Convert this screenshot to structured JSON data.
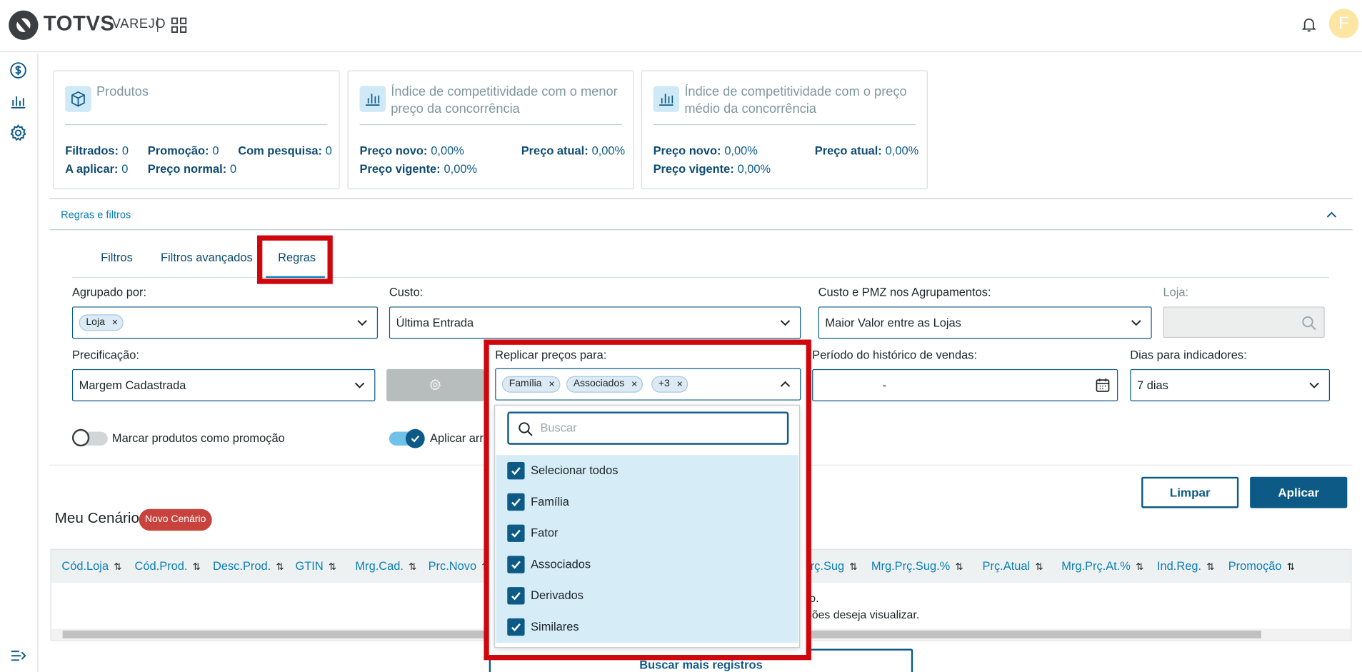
{
  "app": {
    "brand": "TOTVS",
    "brand_sub": "VAREJO",
    "avatar_letter": "F"
  },
  "colors": {
    "primary": "#0d5a86",
    "accent": "#0c7fb5",
    "highlight": "#d0060d",
    "badge": "#c8433d"
  },
  "sidebar": {
    "icons": [
      "dollar-icon",
      "bar-chart-icon",
      "gear-icon",
      "expand-menu-icon"
    ]
  },
  "cards": [
    {
      "title": "Produtos",
      "fields": [
        {
          "label": "Filtrados:",
          "value": "0"
        },
        {
          "label": "Promoção:",
          "value": "0"
        },
        {
          "label": "Com pesquisa:",
          "value": "0"
        },
        {
          "label": "A aplicar:",
          "value": "0"
        },
        {
          "label": "Preço normal:",
          "value": "0"
        }
      ]
    },
    {
      "title_l1": "Índice de competitividade com o menor",
      "title_l2": "preço da concorrência",
      "fields": [
        {
          "label": "Preço novo:",
          "value": "0,00%"
        },
        {
          "label": "Preço atual:",
          "value": "0,00%"
        },
        {
          "label": "Preço vigente:",
          "value": "0,00%"
        }
      ]
    },
    {
      "title_l1": "Índice de competitividade com o preço",
      "title_l2": "médio da concorrência",
      "fields": [
        {
          "label": "Preço novo:",
          "value": "0,00%"
        },
        {
          "label": "Preço atual:",
          "value": "0,00%"
        },
        {
          "label": "Preço vigente:",
          "value": "0,00%"
        }
      ]
    }
  ],
  "rules": {
    "section_title": "Regras e filtros",
    "tabs": [
      "Filtros",
      "Filtros avançados",
      "Regras"
    ],
    "active_tab": "Regras",
    "agrupado": {
      "label": "Agrupado por:",
      "chip": "Loja"
    },
    "custo": {
      "label": "Custo:",
      "value": "Última Entrada"
    },
    "custo_pmz": {
      "label": "Custo e PMZ nos Agrupamentos:",
      "value": "Maior Valor entre as Lojas"
    },
    "loja": {
      "label": "Loja:"
    },
    "precificacao": {
      "label": "Precificação:",
      "value": "Margem Cadastrada"
    },
    "replicar": {
      "label": "Replicar preços para:",
      "chips": [
        "Família",
        "Associados",
        "+3"
      ]
    },
    "periodo": {
      "label": "Período do histórico de vendas:",
      "value": "-"
    },
    "dias": {
      "label": "Dias para indicadores:",
      "value": "7 dias"
    },
    "toggle_promo": {
      "label": "Marcar produtos como promoção",
      "on": false
    },
    "toggle_arred": {
      "label": "Aplicar arred",
      "on": true
    }
  },
  "dropdown": {
    "search_placeholder": "Buscar",
    "options": [
      "Selecionar todos",
      "Família",
      "Fator",
      "Associados",
      "Derivados",
      "Similares"
    ]
  },
  "actions": {
    "clear": "Limpar",
    "apply": "Aplicar"
  },
  "scenario": {
    "title": "Meu Cenário",
    "badge": "Novo Cenário"
  },
  "table": {
    "columns": [
      "Cód.Loja",
      "Cód.Prod.",
      "Desc.Prod.",
      "GTIN",
      "Mrg.Cad.",
      "Prc.Novo",
      "rç.Sug",
      "Mrg.Prç.Sug.%",
      "Prç.Atual",
      "Mrg.Prç.At.%",
      "Ind.Reg.",
      "Promoção"
    ],
    "empty_l1": "oto.",
    "empty_l2": "ações deseja visualizar.",
    "load_more": "Buscar mais registros"
  }
}
